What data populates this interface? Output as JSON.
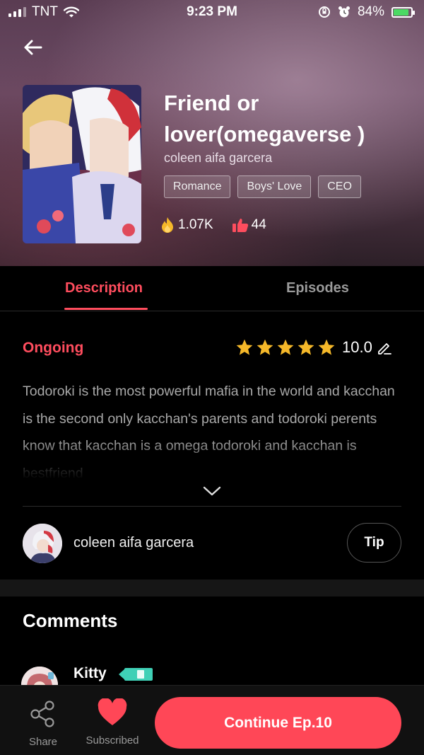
{
  "status_bar": {
    "carrier": "TNT",
    "time": "9:23 PM",
    "battery": "84%"
  },
  "book": {
    "title": "Friend or lover(omegaverse )",
    "author": "coleen aifa garcera",
    "tags": [
      "Romance",
      "Boys' Love",
      "CEO"
    ],
    "views": "1.07K",
    "likes": "44"
  },
  "tabs": {
    "description": "Description",
    "episodes": "Episodes"
  },
  "details": {
    "status": "Ongoing",
    "rating": "10.0",
    "stars": 5,
    "description": "Todoroki is the most powerful mafia in the world and kacchan is the second only kacchan's parents and todoroki perents know that kacchan is a omega todoroki and kacchan is bestfriend"
  },
  "author_row": {
    "name": "coleen aifa garcera",
    "tip_label": "Tip"
  },
  "comments": {
    "heading": "Comments",
    "first_commenter": "Kitty"
  },
  "bottom_bar": {
    "share_label": "Share",
    "subscribed_label": "Subscribed",
    "continue_label": "Continue Ep.10"
  },
  "colors": {
    "accent": "#ff4d5e",
    "button": "#ff4757",
    "background": "#000000"
  }
}
